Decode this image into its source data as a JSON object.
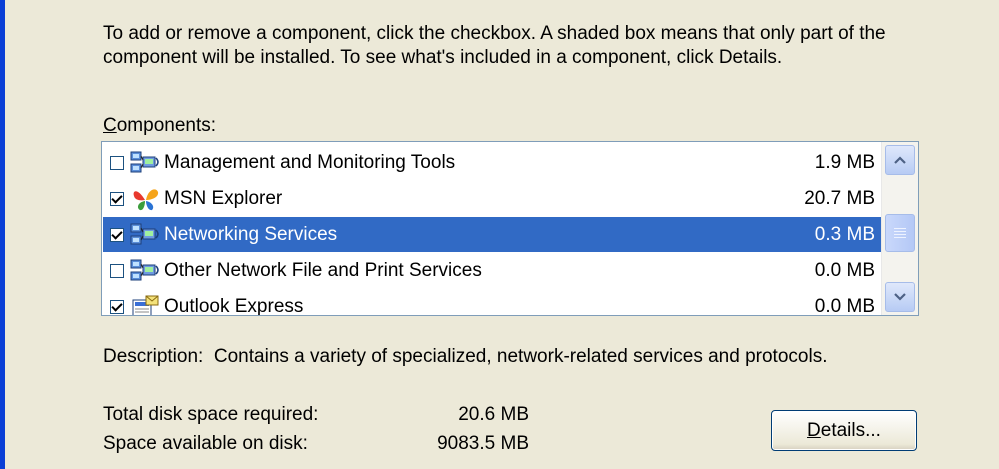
{
  "instructions": "To add or remove a component, click the checkbox.  A shaded box means that only part of the component will be installed.  To see what's included in a component, click Details.",
  "components_label_accel": "C",
  "components_label_rest": "omponents:",
  "components": [
    {
      "name": "Management and Monitoring Tools",
      "size": "1.9 MB",
      "checked": false,
      "selected": false,
      "icon": "network-computers-icon"
    },
    {
      "name": "MSN Explorer",
      "size": "20.7 MB",
      "checked": true,
      "selected": false,
      "icon": "msn-butterfly-icon"
    },
    {
      "name": "Networking Services",
      "size": "0.3 MB",
      "checked": true,
      "selected": true,
      "icon": "network-computers-icon"
    },
    {
      "name": "Other Network File and Print Services",
      "size": "0.0 MB",
      "checked": false,
      "selected": false,
      "icon": "network-computers-icon"
    },
    {
      "name": "Outlook Express",
      "size": "0.0 MB",
      "checked": true,
      "selected": false,
      "icon": "outlook-express-icon"
    }
  ],
  "description_label": "Description:",
  "description_text": "Contains a variety of specialized, network-related services and protocols.",
  "disk": {
    "required_label": "Total disk space required:",
    "required_value": "20.6 MB",
    "available_label": "Space available on disk:",
    "available_value": "9083.5 MB"
  },
  "details_accel": "D",
  "details_rest": "etails...",
  "colors": {
    "selection": "#316ac5",
    "dialog_bg": "#ece9d8",
    "border_blue": "#0a3fd6"
  }
}
